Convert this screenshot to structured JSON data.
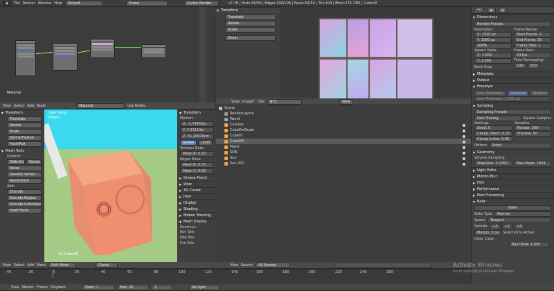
{
  "topbar": {
    "menu": [
      "File",
      "Render",
      "Window",
      "Help"
    ],
    "layout": "Default",
    "scene": "Scene",
    "engine": "Cycles Render",
    "stats": "v2.78 | Verts:56/56 | Edges:100/108 | Faces:54/54 | Tris:100 | Mem:279.73M | CubeUR"
  },
  "node_editor": {
    "label": "Material"
  },
  "image_editor": {
    "title": "Transform",
    "buttons": [
      "Translate",
      "Rotate",
      "Scale"
    ],
    "shear": "Shear"
  },
  "viewport": {
    "header": [
      "View",
      "Select",
      "Add",
      "Node"
    ],
    "material": "Material",
    "use_nodes": "Use Nodes",
    "toolshelf": {
      "transform_title": "Transform",
      "tools": [
        "Translate",
        "Rotate",
        "Scale",
        "Shrink/Flatten",
        "Push/Pull"
      ],
      "mesh_tools_title": "Mesh Tools",
      "deform": "Deform:",
      "slide": [
        "Slide Ed",
        "Vertex"
      ],
      "mesh_tools": [
        "Noise",
        "Smooth Vertex",
        "Randomize"
      ],
      "add": "Add:",
      "extrude": "Extrude",
      "add_tools": [
        "Extrude Region",
        "Extrude Individual",
        "Inset Faces"
      ]
    },
    "persp": "User Persp",
    "meters": "Meters",
    "object": "(1) CubeUR",
    "npanel": {
      "transform": "Transform",
      "median": "Median:",
      "coords": [
        "X: -1.75452m",
        "Y: 7.21513m",
        "Z: 55.20979cm"
      ],
      "global": "Global",
      "local": "Local",
      "vertices_data": "Vertices Data:",
      "mean_b": "Mean B: 0.00",
      "edges_data": "Edges Data:",
      "mean_b2": "Mean B: 0.00",
      "mean_c": "Mean C: 0.00",
      "sections": [
        "Grease Pencil",
        "View",
        "3D Cursor",
        "Item",
        "Display",
        "Shading",
        "Motion Tracking",
        "Mesh Display"
      ],
      "overlays": "Overlays:",
      "checks": [
        "Nor",
        "Edg",
        "Cre",
        "Sea",
        "Bev",
        "Ede"
      ]
    },
    "bottom": [
      "View",
      "Select",
      "Add",
      "Mesh"
    ],
    "mode": "Edit Mode",
    "orientation": "Global"
  },
  "uv_editor": {
    "header": [
      "View",
      "Image*",
      "UVs"
    ],
    "image_name": "NT1",
    "view": "View"
  },
  "outliner": {
    "items": [
      "Scene",
      "RenderLayers",
      "World",
      "Camera",
      "CubeDefScale",
      "CubeHI",
      "CubeUR",
      "Plane",
      "SUN",
      "Sun",
      "Sun.001"
    ],
    "bottom": [
      "View",
      "Search",
      "All Scenes"
    ]
  },
  "properties": {
    "dimensions": "Dimensions",
    "render_presets": "Render Presets",
    "resolution": "Resolution:",
    "res": [
      "X: 1920 px",
      "Y: 1080 px",
      "100%"
    ],
    "frame_range": "Frame Range:",
    "frames": [
      "Start Frame: 1",
      "End Frame: 20",
      "Frame Step: 1"
    ],
    "aspect": "Aspect Ratio:",
    "aspect_vals": [
      "X: 1.000",
      "Y: 1.000"
    ],
    "frame_rate": "Frame Rate:",
    "fps": "24 fps",
    "time_remap": "Time Remapping:",
    "remap": [
      "100",
      "100"
    ],
    "border": "Bord",
    "crop": "Crop",
    "metadata": "Metadata",
    "output": "Output",
    "freestyle": "Freestyle",
    "line_thickness": [
      "Line Thickness:",
      "Absolute",
      "Relative"
    ],
    "line_thick_val": "Line Thickness: 1.000 px",
    "sampling": "Sampling",
    "sampling_presets": "Sampling Presets",
    "path_tracing": "Path Tracing",
    "square_samples": "Square Samples",
    "settings": "Settings:",
    "samples": "Samples:",
    "seed": "Seed: 0",
    "render": "Render: 200",
    "clamp_direct": "Clamp Direct: 0.00",
    "preview": "Preview: 50",
    "clamp_indirect": "Clamp Indire: 0.00",
    "pattern": "Pattern:",
    "sobol": "Sobol",
    "geometry": "Geometry",
    "volume_sampling": "Volume Sampling:",
    "step_size": "Step Size: 0.1000",
    "max_steps": "Max Steps: 1024",
    "light_paths": "Light Paths",
    "motion_blur": "Motion Blur",
    "film": "Film",
    "performance": "Performance",
    "post_processing": "Post Processing",
    "bake": "Bake",
    "bake_btn": "Bake",
    "bake_type": "Bake Type:",
    "normal": "Normal",
    "space": "Space:",
    "tangent": "Tangent",
    "swizzle": "Swizzle:",
    "swz": [
      "+X",
      "+Y",
      "+Z"
    ],
    "margin": "Margin: 5 px",
    "selected_to_active": "Selected to Active",
    "clear": "Clear",
    "cage": "Cage",
    "ray_dist": "Ray Dista: 1.000"
  },
  "timeline": {
    "header": [
      "View",
      "Marker",
      "Frame",
      "Playback"
    ],
    "start": "Start: 1",
    "end": "End: 20",
    "frame": "1",
    "sync": "No Sync",
    "ticks": [
      "-40",
      "-20",
      "0",
      "20",
      "40",
      "60",
      "80",
      "100",
      "120",
      "140",
      "160",
      "180",
      "200",
      "220",
      "240",
      "260"
    ]
  },
  "watermark": {
    "line1": "Activate Windows",
    "line2": "Go to Settings to activate Windows."
  }
}
